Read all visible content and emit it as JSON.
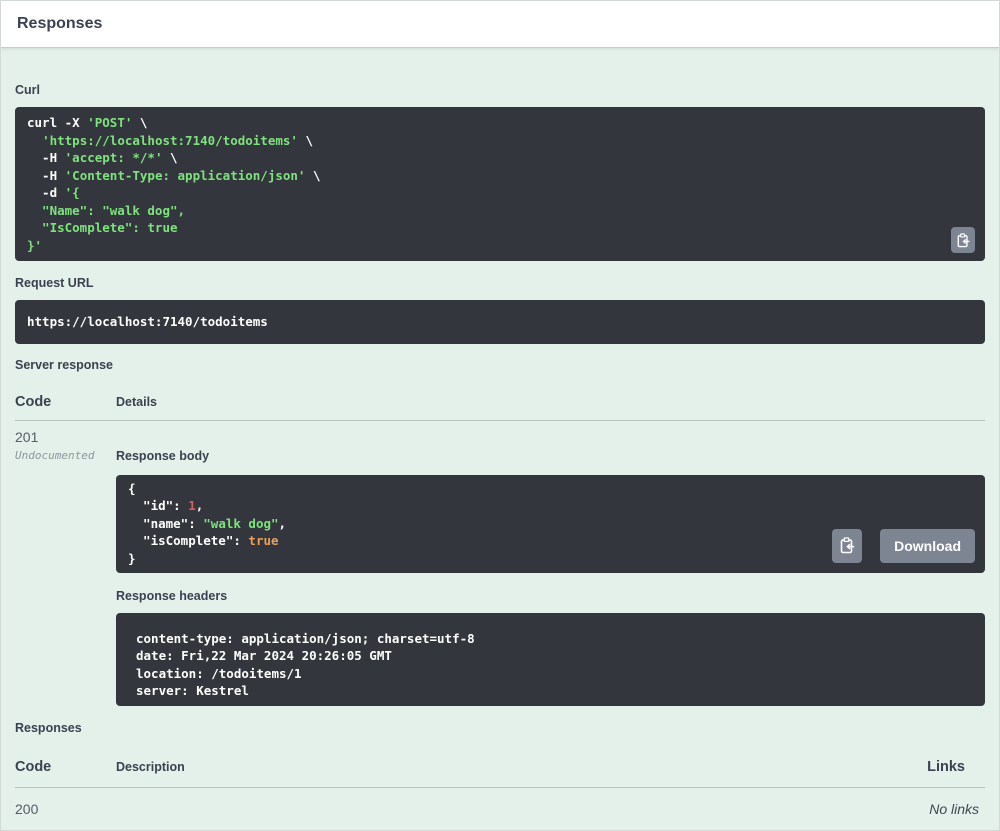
{
  "panel": {
    "title": "Responses"
  },
  "colors": {
    "body_bg": "#e4f1ea",
    "code_bg": "#33363c",
    "string_green": "#7ee37e",
    "number_red": "#d36060",
    "literal_orange": "#e8a158",
    "button_gray": "#7d8492",
    "label_dark": "#3b4151"
  },
  "request": {
    "curl_label": "Curl",
    "curl_lines": [
      [
        {
          "c": "w",
          "t": "curl -X "
        },
        {
          "c": "g",
          "t": "'POST'"
        },
        {
          "c": "w",
          "t": " \\"
        }
      ],
      [
        {
          "c": "w",
          "t": "  "
        },
        {
          "c": "g",
          "t": "'https://localhost:7140/todoitems'"
        },
        {
          "c": "w",
          "t": " \\"
        }
      ],
      [
        {
          "c": "w",
          "t": "  -H "
        },
        {
          "c": "g",
          "t": "'accept: */*'"
        },
        {
          "c": "w",
          "t": " \\"
        }
      ],
      [
        {
          "c": "w",
          "t": "  -H "
        },
        {
          "c": "g",
          "t": "'Content-Type: application/json'"
        },
        {
          "c": "w",
          "t": " \\"
        }
      ],
      [
        {
          "c": "w",
          "t": "  -d "
        },
        {
          "c": "g",
          "t": "'{"
        }
      ],
      [
        {
          "c": "g",
          "t": "  \"Name\": \"walk dog\","
        }
      ],
      [
        {
          "c": "g",
          "t": "  \"IsComplete\": true"
        }
      ],
      [
        {
          "c": "g",
          "t": "}'"
        }
      ]
    ],
    "request_url_label": "Request URL",
    "request_url": "https://localhost:7140/todoitems"
  },
  "server_response": {
    "label": "Server response",
    "code_header": "Code",
    "details_header": "Details",
    "row": {
      "code": "201",
      "undocumented": "Undocumented",
      "response_body_label": "Response body",
      "body_lines": [
        [
          {
            "c": "w",
            "t": "{"
          }
        ],
        [
          {
            "c": "w",
            "t": "  \"id\": "
          },
          {
            "c": "r",
            "t": "1"
          },
          {
            "c": "w",
            "t": ","
          }
        ],
        [
          {
            "c": "w",
            "t": "  \"name\": "
          },
          {
            "c": "g",
            "t": "\"walk dog\""
          },
          {
            "c": "w",
            "t": ","
          }
        ],
        [
          {
            "c": "w",
            "t": "  \"isComplete\": "
          },
          {
            "c": "o",
            "t": "true"
          }
        ],
        [
          {
            "c": "w",
            "t": "}"
          }
        ]
      ],
      "download_label": "Download",
      "response_headers_label": "Response headers",
      "header_lines": [
        [
          {
            "c": "w",
            "t": "content-type: application/json; charset=utf-8 "
          }
        ],
        [
          {
            "c": "w",
            "t": "date: Fri,22 Mar 2024 20:26:05 GMT "
          }
        ],
        [
          {
            "c": "w",
            "t": "location: /todoitems/1 "
          }
        ],
        [
          {
            "c": "w",
            "t": "server: Kestrel "
          }
        ]
      ]
    }
  },
  "responses_table": {
    "label": "Responses",
    "code_header": "Code",
    "description_header": "Description",
    "links_header": "Links",
    "rows": [
      {
        "code": "200",
        "description": "",
        "links": "No links"
      }
    ]
  }
}
